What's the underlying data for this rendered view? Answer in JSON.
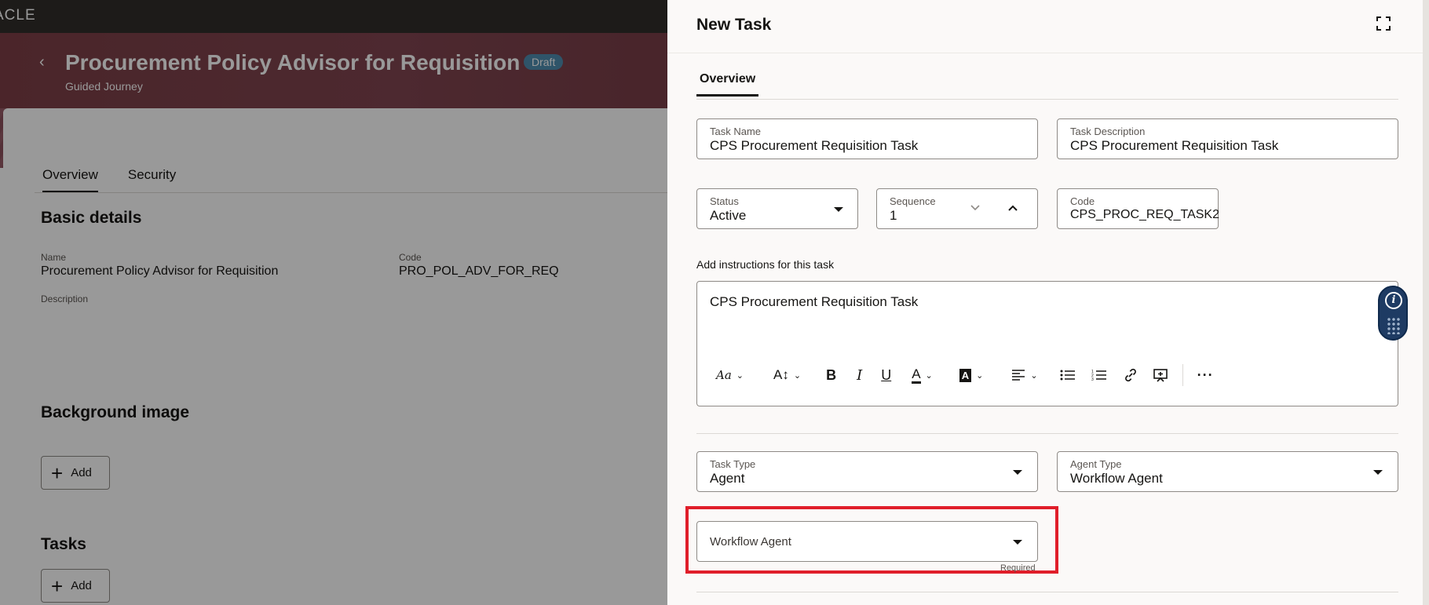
{
  "topbar": {
    "brand": "ACLE"
  },
  "hero": {
    "back_icon": "chevron-left-icon",
    "title": "Procurement Policy Advisor for Requisition",
    "badge": "Draft",
    "subtitle": "Guided Journey"
  },
  "page_tabs": [
    {
      "label": "Overview",
      "active": true
    },
    {
      "label": "Security",
      "active": false
    }
  ],
  "basic_details": {
    "heading": "Basic details",
    "name_label": "Name",
    "name_value": "Procurement Policy Advisor for Requisition",
    "code_label": "Code",
    "code_value": "PRO_POL_ADV_FOR_REQ",
    "description_label": "Description"
  },
  "background_image": {
    "heading": "Background image",
    "add_label": "Add"
  },
  "tasks": {
    "heading": "Tasks",
    "add_label": "Add"
  },
  "drawer": {
    "title": "New Task",
    "expand_icon": "expand-icon",
    "tab": "Overview",
    "task_name": {
      "label": "Task Name",
      "value": "CPS Procurement Requisition Task"
    },
    "task_description": {
      "label": "Task Description",
      "value": "CPS Procurement Requisition Task"
    },
    "status": {
      "label": "Status",
      "value": "Active"
    },
    "sequence": {
      "label": "Sequence",
      "value": "1"
    },
    "code": {
      "label": "Code",
      "value": "CPS_PROC_REQ_TASK2"
    },
    "instructions_label": "Add instructions for this task",
    "instructions_text": "CPS Procurement Requisition Task",
    "toolbar": {
      "font": "Aa",
      "size": "A↕",
      "bold": "B",
      "italic": "I",
      "underline": "U",
      "text_color": "A",
      "bg_color": "A",
      "more": "···"
    },
    "task_type": {
      "label": "Task Type",
      "value": "Agent"
    },
    "agent_type": {
      "label": "Agent Type",
      "value": "Workflow Agent"
    },
    "workflow_agent": {
      "placeholder": "Workflow Agent",
      "required": "Required"
    }
  },
  "colors": {
    "hero": "#7d3f47",
    "badge": "#4f8db0",
    "highlight": "#e01e2a",
    "info_widget": "#1e3b63"
  }
}
